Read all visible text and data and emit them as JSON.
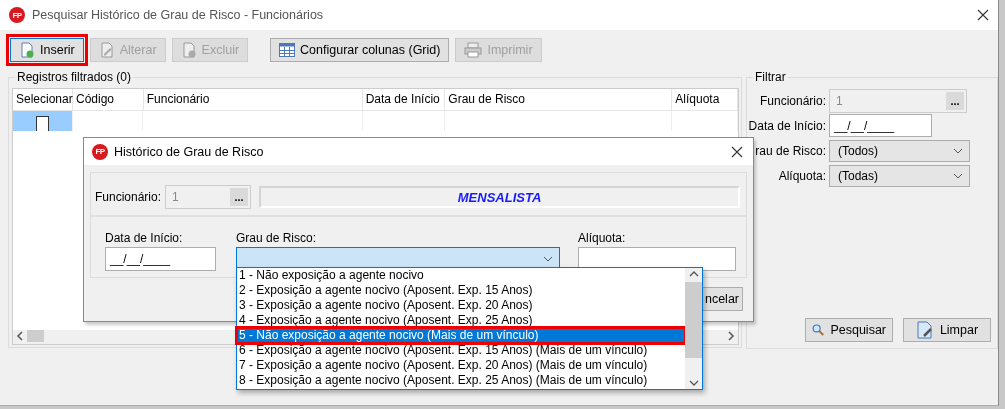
{
  "window": {
    "logo": "FP",
    "title": "Pesquisar Histórico de Grau de Risco - Funcionários"
  },
  "toolbar": [
    {
      "label": "Inserir",
      "kind": "insert",
      "disabled": false,
      "highlighted": true
    },
    {
      "label": "Alterar",
      "kind": "edit",
      "disabled": true,
      "highlighted": false
    },
    {
      "label": "Excluir",
      "kind": "delete",
      "disabled": true,
      "highlighted": false
    },
    {
      "label": "Configurar colunas (Grid)",
      "kind": "grid",
      "disabled": false,
      "highlighted": false
    },
    {
      "label": "Imprimir",
      "kind": "print",
      "disabled": true,
      "highlighted": false
    }
  ],
  "records": {
    "title": "Registros filtrados (0)",
    "columns": [
      "Selecionar",
      "Código",
      "Funcionário",
      "Data de Início",
      "Grau de Risco",
      "Alíquota"
    ],
    "rows": [
      {
        "checked": false,
        "selected": true
      }
    ]
  },
  "filter": {
    "title": "Filtrar",
    "fields": [
      {
        "label": "Funcionário:",
        "kind": "lookup",
        "value": "1",
        "button": "..."
      },
      {
        "label": "Data de Início:",
        "kind": "date",
        "value": "__/__/____"
      },
      {
        "label": "rau de Risco:",
        "kind": "combo",
        "value": "(Todos)"
      },
      {
        "label": "Alíquota:",
        "kind": "combo",
        "value": "(Todas)"
      }
    ],
    "buttons": [
      {
        "label": "Pesquisar",
        "kind": "search"
      },
      {
        "label": "Limpar",
        "kind": "clear"
      }
    ]
  },
  "dialog": {
    "logo": "FP",
    "title": "Histórico de Grau de Risco",
    "employee": {
      "label": "Funcionário:",
      "value": "1",
      "button": "...",
      "name": "MENSALISTA"
    },
    "fields": [
      {
        "label": "Data de Início:",
        "kind": "date",
        "value": "__/__/____",
        "focused": false
      },
      {
        "label": "Grau de Risco:",
        "kind": "combo",
        "focused": true
      },
      {
        "label": "Alíquota:",
        "kind": "text",
        "focused": false
      }
    ],
    "cancel": "ncelar"
  },
  "dropdown": {
    "items": [
      {
        "label": "1 - Não exposição a agente nocivo",
        "selected": false,
        "highlighted": false
      },
      {
        "label": "2 - Exposição a agente nocivo (Aposent. Exp. 15 Anos)",
        "selected": false,
        "highlighted": false
      },
      {
        "label": "3 - Exposição a agente nocivo (Aposent. Exp. 20 Anos)",
        "selected": false,
        "highlighted": false
      },
      {
        "label": "4 - Exposição a agente nocivo (Aposent. Exp. 25 Anos)",
        "selected": false,
        "highlighted": false
      },
      {
        "label": "5 - Não exposição a agente nocivo (Mais de um vínculo)",
        "selected": true,
        "highlighted": true
      },
      {
        "label": "6 - Exposição a agente nocivo (Aposent. Exp. 15 Anos) (Mais de um vínculo)",
        "selected": false,
        "highlighted": false
      },
      {
        "label": "7 - Exposição a agente nocivo (Aposent. Exp. 20 Anos) (Mais de um vínculo)",
        "selected": false,
        "highlighted": false
      },
      {
        "label": "8 - Exposição a agente nocivo (Aposent. Exp. 25 Anos) (Mais de um vínculo)",
        "selected": false,
        "highlighted": false
      }
    ]
  }
}
